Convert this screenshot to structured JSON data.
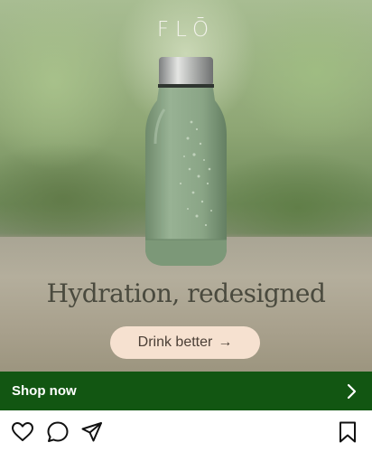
{
  "ad": {
    "brand": "FLŌ",
    "headline": "Hydration, redesigned",
    "cta_label": "Drink better",
    "cta_arrow": "→"
  },
  "shop_bar": {
    "label": "Shop now",
    "color": "#125612"
  },
  "actions": {
    "like_icon": "heart-icon",
    "comment_icon": "comment-icon",
    "share_icon": "send-icon",
    "save_icon": "bookmark-icon"
  },
  "colors": {
    "cta_background": "#f6e1d0",
    "bottle": "#8ea98a",
    "headline_text": "#4a4a3e"
  }
}
